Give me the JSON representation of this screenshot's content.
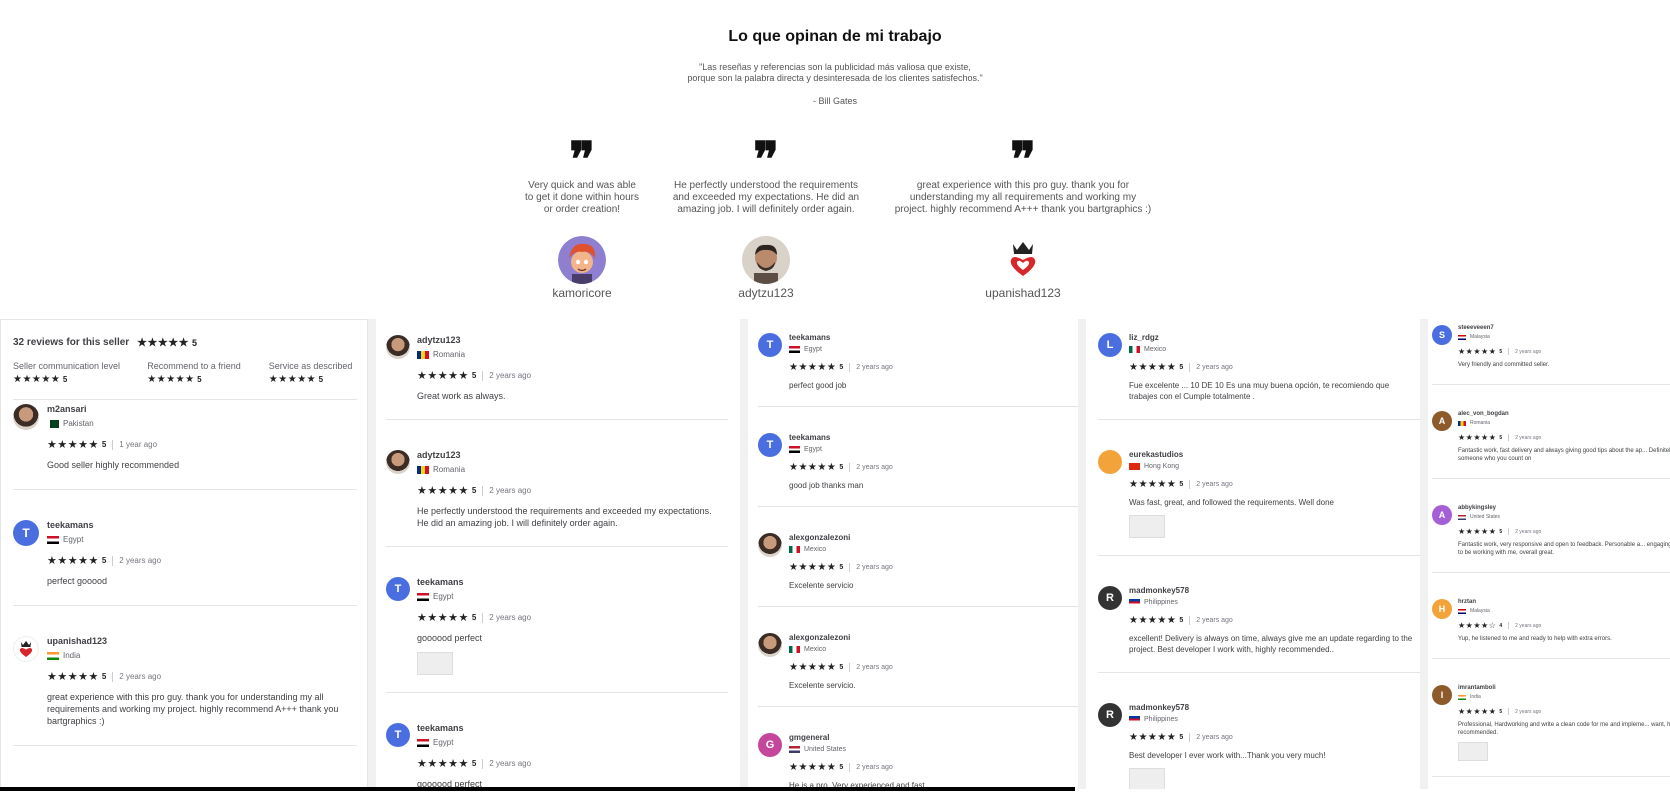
{
  "hero": {
    "title": "Lo que opinan de mi trabajo",
    "quote": "\"Las reseñas y referencias son la publicidad más valiosa que existe, porque son la palabra directa y desinteresada de los clientes satisfechos.\"",
    "author": "- Bill Gates",
    "testimonials": [
      {
        "text": "Very quick and was able to get it done within hours or order creation!",
        "name": "kamoricore"
      },
      {
        "text": "He perfectly understood the requirements and exceeded my expectations. He did an amazing job. I will definitely order again.",
        "name": "adytzu123"
      },
      {
        "text": "great experience with this pro guy. thank you for understanding my all requirements and working my project. highly recommend A+++ thank you bartgraphics :)",
        "name": "upanishad123"
      }
    ]
  },
  "summary": {
    "title": "32 reviews for this seller",
    "stars": "★★★★★",
    "score": "5",
    "categories": [
      {
        "label": "Seller communication level",
        "stars": "★★★★★",
        "score": "5"
      },
      {
        "label": "Recommend to a friend",
        "stars": "★★★★★",
        "score": "5"
      },
      {
        "label": "Service as described",
        "stars": "★★★★★",
        "score": "5"
      }
    ]
  },
  "colors": {
    "blue": "#4a6ee0",
    "dark": "#333333",
    "orange": "#f2a33a",
    "purple": "#a55fd6",
    "brown": "#8c5a2b",
    "magenta": "#c4479b",
    "photo": "#a07f6a"
  },
  "columns": [
    {
      "reviews": [
        {
          "user": "m2ansari",
          "country": "Pakistan",
          "stars": "★★★★★",
          "score": "5",
          "ago": "1 year ago",
          "text": "Good seller highly recommended",
          "initial": "",
          "avatar": "photo"
        },
        {
          "user": "teekamans",
          "country": "Egypt",
          "stars": "★★★★★",
          "score": "5",
          "ago": "2 years ago",
          "text": "perfect gooood",
          "initial": "T",
          "avatar": "blue"
        },
        {
          "user": "upanishad123",
          "country": "India",
          "stars": "★★★★★",
          "score": "5",
          "ago": "2 years ago",
          "text": "great experience with this pro guy. thank you for understanding my all requirements and working my project. highly recommend A+++ thank you bartgraphics :)",
          "initial": "",
          "avatar": "logo"
        }
      ]
    },
    {
      "reviews": [
        {
          "user": "adytzu123",
          "country": "Romania",
          "stars": "★★★★★",
          "score": "5",
          "ago": "2 years ago",
          "text": "Great work as always.",
          "initial": "",
          "avatar": "photo"
        },
        {
          "user": "adytzu123",
          "country": "Romania",
          "stars": "★★★★★",
          "score": "5",
          "ago": "2 years ago",
          "text": "He perfectly understood the requirements and exceeded my expectations. He did an amazing job. I will definitely order again.",
          "initial": "",
          "avatar": "photo"
        },
        {
          "user": "teekamans",
          "country": "Egypt",
          "stars": "★★★★★",
          "score": "5",
          "ago": "2 years ago",
          "text": "goooood perfect",
          "initial": "T",
          "avatar": "blue",
          "thumb": true
        },
        {
          "user": "teekamans",
          "country": "Egypt",
          "stars": "★★★★★",
          "score": "5",
          "ago": "2 years ago",
          "text": "goooood perfect",
          "initial": "T",
          "avatar": "blue"
        }
      ]
    },
    {
      "reviews": [
        {
          "user": "teekamans",
          "country": "Egypt",
          "stars": "★★★★★",
          "score": "5",
          "ago": "2 years ago",
          "text": "perfect good job",
          "initial": "T",
          "avatar": "blue"
        },
        {
          "user": "teekamans",
          "country": "Egypt",
          "stars": "★★★★★",
          "score": "5",
          "ago": "2 years ago",
          "text": "good job thanks man",
          "initial": "T",
          "avatar": "blue"
        },
        {
          "user": "alexgonzalezoni",
          "country": "Mexico",
          "stars": "★★★★★",
          "score": "5",
          "ago": "2 years ago",
          "text": "Excelente servicio",
          "initial": "",
          "avatar": "photo"
        },
        {
          "user": "alexgonzalezoni",
          "country": "Mexico",
          "stars": "★★★★★",
          "score": "5",
          "ago": "2 years ago",
          "text": "Excelente servicio.",
          "initial": "",
          "avatar": "photo"
        },
        {
          "user": "gmgeneral",
          "country": "United States",
          "stars": "★★★★★",
          "score": "5",
          "ago": "2 years ago",
          "text": "He is a pro. Very experienced and fast.",
          "initial": "G",
          "avatar": "magenta"
        }
      ]
    },
    {
      "reviews": [
        {
          "user": "liz_rdgz",
          "country": "Mexico",
          "stars": "★★★★★",
          "score": "5",
          "ago": "2 years ago",
          "text": "Fue excelente ... 10 DE 10 Es una muy buena opción, te recomiendo que trabajes con el Cumple totalmente .",
          "initial": "L",
          "avatar": "blue"
        },
        {
          "user": "eurekastudios",
          "country": "Hong Kong",
          "stars": "★★★★★",
          "score": "5",
          "ago": "2 years ago",
          "text": "Was fast, great, and followed the requirements. Well done",
          "initial": "",
          "avatar": "orange",
          "thumb": true
        },
        {
          "user": "madmonkey578",
          "country": "Philippines",
          "stars": "★★★★★",
          "score": "5",
          "ago": "2 years ago",
          "text": "excellent! Delivery is always on time, always give me an update regarding to the project. Best developer I work with, highly recommended..",
          "initial": "R",
          "avatar": "dark"
        },
        {
          "user": "madmonkey578",
          "country": "Philippines",
          "stars": "★★★★★",
          "score": "5",
          "ago": "2 years ago",
          "text": "Best developer I ever work with...Thank you very much!",
          "initial": "R",
          "avatar": "dark",
          "thumb": true
        }
      ]
    },
    {
      "reviews": [
        {
          "user": "steeeveeen7",
          "country": "Malaysia",
          "stars": "★★★★★",
          "score": "5",
          "ago": "2 years ago",
          "text": "Very friendly and committed seller.",
          "initial": "S",
          "avatar": "blue"
        },
        {
          "user": "alec_von_bogdan",
          "country": "Romania",
          "stars": "★★★★★",
          "score": "5",
          "ago": "2 years ago",
          "text": "Fantastic work, fast delivery and always giving good tips about the ap... Definitely someone who you count on",
          "initial": "A",
          "avatar": "brown"
        },
        {
          "user": "abbykingsley",
          "country": "United States",
          "stars": "★★★★★",
          "score": "5",
          "ago": "2 years ago",
          "text": "Fantastic work, very responsive and open to feedback. Personable a... engaging, excited to be working with me, overall great.",
          "initial": "A",
          "avatar": "purple"
        },
        {
          "user": "hrztan",
          "country": "Malaysia",
          "stars": "★★★★☆",
          "score": "4",
          "ago": "2 years ago",
          "text": "Yup, he listened to me and ready to help with extra errors.",
          "initial": "H",
          "avatar": "orange"
        },
        {
          "user": "imrantamboli",
          "country": "India",
          "stars": "★★★★★",
          "score": "5",
          "ago": "2 years ago",
          "text": "Professional, Hardworking and write a clean code for me and impleme... want, highly recommended.",
          "initial": "I",
          "avatar": "brown",
          "thumb": true
        }
      ]
    }
  ]
}
